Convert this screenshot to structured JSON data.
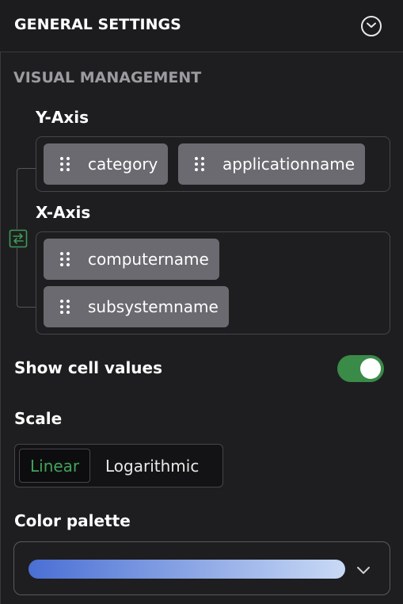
{
  "header": {
    "title": "GENERAL SETTINGS",
    "collapse_icon": "chevron-down-circle-icon"
  },
  "section": {
    "title": "VISUAL MANAGEMENT"
  },
  "y_axis": {
    "label": "Y-Axis",
    "fields": [
      "category",
      "applicationname"
    ]
  },
  "x_axis": {
    "label": "X-Axis",
    "fields": [
      "computername",
      "subsystemname"
    ]
  },
  "swap_icon": "swap-axes-icon",
  "toggle": {
    "label": "Show cell values",
    "on": true,
    "color": "#3a8a48"
  },
  "scale": {
    "label": "Scale",
    "options": [
      "Linear",
      "Logarithmic"
    ],
    "selected": "Linear",
    "accent": "#43a35b"
  },
  "palette": {
    "label": "Color palette",
    "gradient_start": "#4a6fd4",
    "gradient_end": "#c9daf5"
  }
}
